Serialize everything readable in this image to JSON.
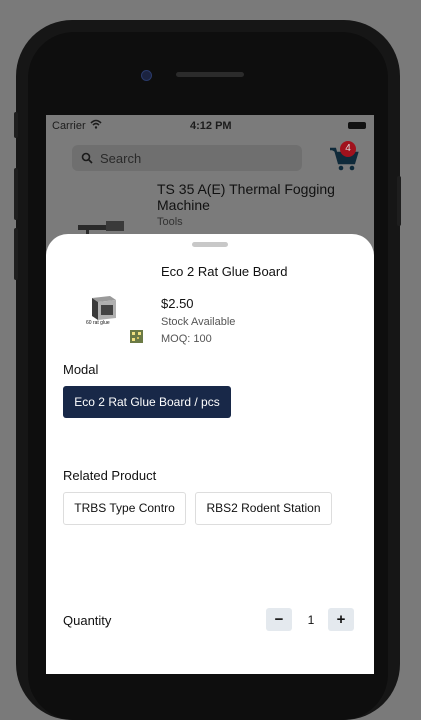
{
  "status_bar": {
    "carrier": "Carrier",
    "time": "4:12 PM"
  },
  "header": {
    "search_placeholder": "Search",
    "cart_count": "4"
  },
  "background_product": {
    "name": "TS 35 A(E) Thermal Fogging Machine",
    "category": "Tools"
  },
  "sheet": {
    "item": {
      "name": "Eco 2 Rat Glue Board",
      "thumb_label": "60 rat glue",
      "price": "$2.50",
      "stock": "Stock Available",
      "moq": "MOQ: 100"
    },
    "modal_label": "Modal",
    "variant_button": "Eco 2 Rat Glue Board / pcs",
    "related_label": "Related Product",
    "related_products": [
      "TRBS Type Contro",
      "RBS2 Rodent Station"
    ],
    "quantity_label": "Quantity",
    "quantity_value": "1",
    "minus_label": "−",
    "plus_label": "+"
  },
  "colors": {
    "primary": "#182848",
    "badge": "#a0121d"
  }
}
